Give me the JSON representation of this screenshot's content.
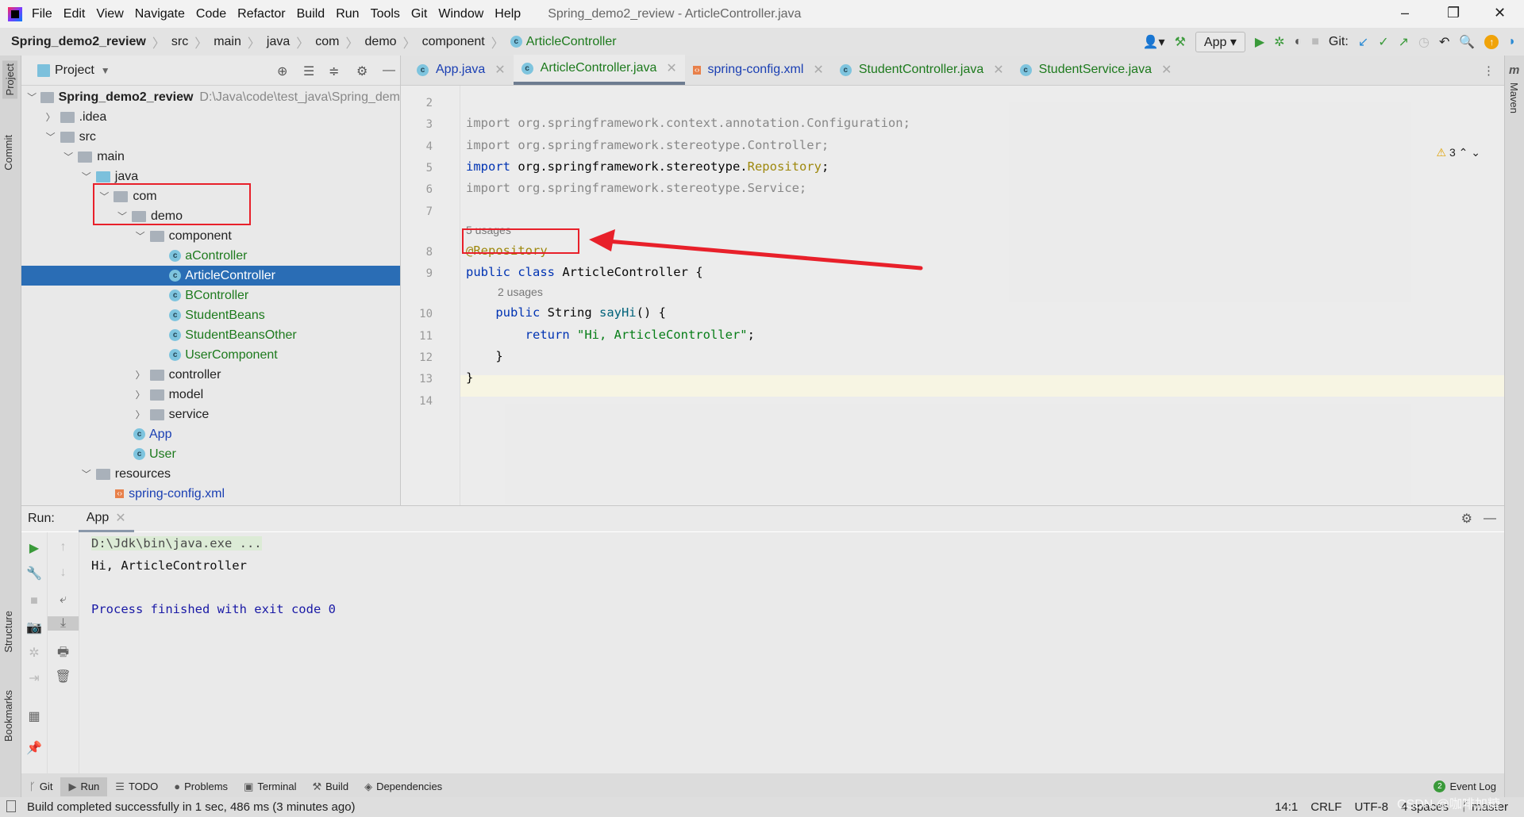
{
  "window": {
    "title": "Spring_demo2_review - ArticleController.java",
    "menus": [
      "File",
      "Edit",
      "View",
      "Navigate",
      "Code",
      "Refactor",
      "Build",
      "Run",
      "Tools",
      "Git",
      "Window",
      "Help"
    ],
    "controls": [
      "–",
      "❐",
      "✕"
    ]
  },
  "breadcrumb": [
    "Spring_demo2_review",
    "src",
    "main",
    "java",
    "com",
    "demo",
    "component",
    "ArticleController"
  ],
  "toolbar": {
    "run_config": "App",
    "git_label": "Git:"
  },
  "stripes": {
    "left_top": [
      "Project",
      "Commit"
    ],
    "left_bottom": [
      "Structure",
      "Bookmarks"
    ],
    "right": [
      "Maven"
    ]
  },
  "project": {
    "title": "Project",
    "tree": [
      {
        "label": "Spring_demo2_review",
        "hint": "D:\\Java\\code\\test_java\\Spring_dem",
        "depth": 0,
        "kind": "module",
        "open": true,
        "bold": true
      },
      {
        "label": ".idea",
        "depth": 1,
        "kind": "folder",
        "open": false
      },
      {
        "label": "src",
        "depth": 1,
        "kind": "folder",
        "open": true
      },
      {
        "label": "main",
        "depth": 2,
        "kind": "folder",
        "open": true
      },
      {
        "label": "java",
        "depth": 3,
        "kind": "src",
        "open": true
      },
      {
        "label": "com",
        "depth": 4,
        "kind": "package",
        "open": true
      },
      {
        "label": "demo",
        "depth": 5,
        "kind": "package",
        "open": true
      },
      {
        "label": "component",
        "depth": 6,
        "kind": "package",
        "open": true
      },
      {
        "label": "aController",
        "depth": 7,
        "kind": "class",
        "color": "green"
      },
      {
        "label": "ArticleController",
        "depth": 7,
        "kind": "class",
        "selected": true
      },
      {
        "label": "BController",
        "depth": 7,
        "kind": "class",
        "color": "green"
      },
      {
        "label": "StudentBeans",
        "depth": 7,
        "kind": "class",
        "color": "green"
      },
      {
        "label": "StudentBeansOther",
        "depth": 7,
        "kind": "class",
        "color": "green"
      },
      {
        "label": "UserComponent",
        "depth": 7,
        "kind": "class",
        "color": "green"
      },
      {
        "label": "controller",
        "depth": 6,
        "kind": "package",
        "open": false
      },
      {
        "label": "model",
        "depth": 6,
        "kind": "package",
        "open": false
      },
      {
        "label": "service",
        "depth": 6,
        "kind": "package",
        "open": false
      },
      {
        "label": "App",
        "depth": 5,
        "kind": "class",
        "color": "blue"
      },
      {
        "label": "User",
        "depth": 5,
        "kind": "class",
        "color": "green"
      },
      {
        "label": "resources",
        "depth": 3,
        "kind": "folder",
        "open": true
      },
      {
        "label": "spring-config.xml",
        "depth": 4,
        "kind": "xml",
        "color": "blue"
      }
    ]
  },
  "editor": {
    "tabs": [
      {
        "label": "App.java",
        "color": "blue",
        "icon": "class"
      },
      {
        "label": "ArticleController.java",
        "color": "green",
        "icon": "class",
        "active": true
      },
      {
        "label": "spring-config.xml",
        "color": "blue",
        "icon": "xml"
      },
      {
        "label": "StudentController.java",
        "color": "green",
        "icon": "class"
      },
      {
        "label": "StudentService.java",
        "color": "green",
        "icon": "class"
      }
    ],
    "warnings": "3",
    "lines": [
      {
        "n": "2",
        "tokens": []
      },
      {
        "n": "3",
        "tokens": [
          [
            "imp",
            "import org.springframework.context.annotation.Configuration;"
          ]
        ]
      },
      {
        "n": "4",
        "tokens": [
          [
            "imp",
            "import org.springframework.stereotype.Controller;"
          ]
        ]
      },
      {
        "n": "5",
        "tokens": [
          [
            "kw",
            "import "
          ],
          [
            "id",
            "org.springframework.stereotype."
          ],
          [
            "ann",
            "Repository"
          ],
          [
            "id",
            ";"
          ]
        ]
      },
      {
        "n": "6",
        "tokens": [
          [
            "imp",
            "import org.springframework.stereotype.Service;"
          ]
        ]
      },
      {
        "n": "7",
        "tokens": []
      },
      {
        "usage": "5 usages",
        "indent": 0
      },
      {
        "n": "8",
        "tokens": [
          [
            "ann",
            "@Repository"
          ]
        ]
      },
      {
        "n": "9",
        "tokens": [
          [
            "kw",
            "public class "
          ],
          [
            "id",
            "ArticleController {"
          ]
        ]
      },
      {
        "usage": "2 usages",
        "indent": 1
      },
      {
        "n": "10",
        "tokens": [
          [
            "id",
            "    "
          ],
          [
            "kw",
            "public "
          ],
          [
            "id",
            "String "
          ],
          [
            "fn",
            "sayHi"
          ],
          [
            "id",
            "() {"
          ]
        ]
      },
      {
        "n": "11",
        "tokens": [
          [
            "id",
            "        "
          ],
          [
            "kw",
            "return "
          ],
          [
            "str",
            "\"Hi, ArticleController\""
          ],
          [
            "id",
            ";"
          ]
        ]
      },
      {
        "n": "12",
        "tokens": [
          [
            "id",
            "    }"
          ]
        ]
      },
      {
        "n": "13",
        "tokens": [
          [
            "id",
            "}"
          ]
        ]
      },
      {
        "n": "14",
        "tokens": []
      }
    ]
  },
  "run": {
    "label": "Run:",
    "tab": "App",
    "output": [
      {
        "text": "D:\\Jdk\\bin\\java.exe ...",
        "color": "#4a4a4a"
      },
      {
        "text": "Hi, ArticleController",
        "color": "#111111"
      },
      {
        "text": "",
        "color": "#111"
      },
      {
        "text": "Process finished with exit code 0",
        "color": "#1a1aa6"
      }
    ]
  },
  "toolwindows": [
    {
      "label": "Git",
      "icon": "git-icon"
    },
    {
      "label": "Run",
      "icon": "run-icon",
      "active": true
    },
    {
      "label": "TODO",
      "icon": "todo-icon"
    },
    {
      "label": "Problems",
      "icon": "problems-icon"
    },
    {
      "label": "Terminal",
      "icon": "terminal-icon"
    },
    {
      "label": "Build",
      "icon": "build-icon"
    },
    {
      "label": "Dependencies",
      "icon": "dependencies-icon"
    }
  ],
  "event_log": {
    "label": "Event Log",
    "count": "2"
  },
  "status": {
    "message": "Build completed successfully in 1 sec, 486 ms (3 minutes ago)",
    "position": "14:1",
    "line_sep": "CRLF",
    "encoding": "UTF-8",
    "indent": "4 spaces",
    "branch": "master"
  },
  "watermark": "CSDN @咖啡加糖",
  "colors": {
    "selection": "#2a6db5",
    "highlight_box": "#e8202a",
    "annotation": "#9e880d",
    "keyword": "#0033b3"
  }
}
